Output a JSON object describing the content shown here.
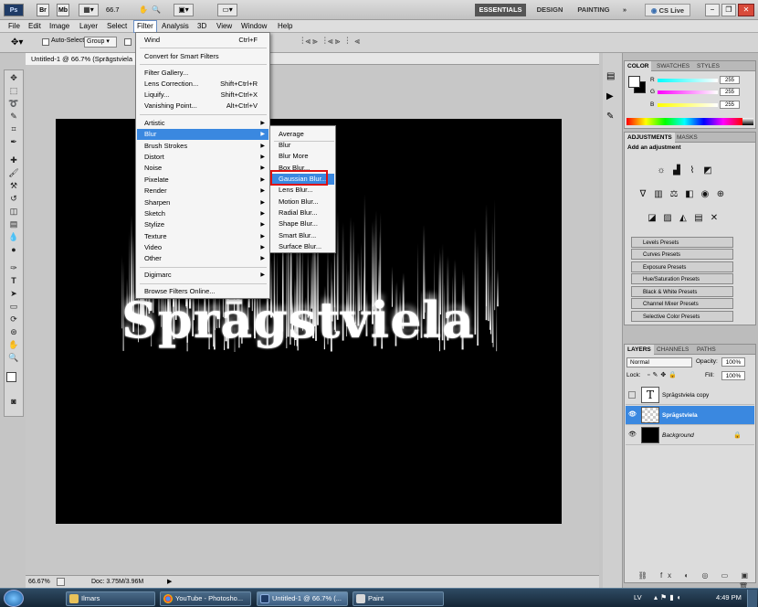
{
  "appbar": {
    "br_label": "Br",
    "mb_label": "Mb",
    "zoom_value": "66.7",
    "workspaces": [
      "ESSENTIALS",
      "DESIGN",
      "PAINTING"
    ],
    "overflow": "»",
    "cslive_label": "CS Live"
  },
  "menubar": [
    "File",
    "Edit",
    "Image",
    "Layer",
    "Select",
    "Filter",
    "Analysis",
    "3D",
    "View",
    "Window",
    "Help"
  ],
  "options": {
    "auto_select_label": "Auto-Select:",
    "auto_select_value": "Group"
  },
  "document": {
    "tab_title": "Untitled-1 @ 66.7% (Sprāgstviela",
    "canvas_text": "Sprāgstviela"
  },
  "filter_menu": {
    "items": [
      {
        "label": "Wind",
        "shortcut": "Ctrl+F"
      },
      {
        "label": "Convert for Smart Filters"
      },
      {
        "label": "Filter Gallery..."
      },
      {
        "label": "Lens Correction...",
        "shortcut": "Shift+Ctrl+R"
      },
      {
        "label": "Liquify...",
        "shortcut": "Shift+Ctrl+X"
      },
      {
        "label": "Vanishing Point...",
        "shortcut": "Alt+Ctrl+V"
      },
      {
        "label": "Artistic"
      },
      {
        "label": "Blur"
      },
      {
        "label": "Brush Strokes"
      },
      {
        "label": "Distort"
      },
      {
        "label": "Noise"
      },
      {
        "label": "Pixelate"
      },
      {
        "label": "Render"
      },
      {
        "label": "Sharpen"
      },
      {
        "label": "Sketch"
      },
      {
        "label": "Stylize"
      },
      {
        "label": "Texture"
      },
      {
        "label": "Video"
      },
      {
        "label": "Other"
      },
      {
        "label": "Digimarc"
      },
      {
        "label": "Browse Filters Online..."
      }
    ]
  },
  "blur_menu": {
    "items": [
      "Average",
      "Blur",
      "Blur More",
      "Box Blur...",
      "Gaussian Blur...",
      "Lens Blur...",
      "Motion Blur...",
      "Radial Blur...",
      "Shape Blur...",
      "Smart Blur...",
      "Surface Blur..."
    ]
  },
  "status": {
    "zoom": "66.67%",
    "doc": "Doc: 3.75M/3.96M"
  },
  "color_panel": {
    "tabs": [
      "COLOR",
      "SWATCHES",
      "STYLES"
    ],
    "channels": [
      {
        "label": "R",
        "value": "255"
      },
      {
        "label": "G",
        "value": "255"
      },
      {
        "label": "B",
        "value": "255"
      }
    ]
  },
  "adjustments_panel": {
    "tabs": [
      "ADJUSTMENTS",
      "MASKS"
    ],
    "heading": "Add an adjustment",
    "presets": [
      "Levels Presets",
      "Curves Presets",
      "Exposure Presets",
      "Hue/Saturation Presets",
      "Black & White Presets",
      "Channel Mixer Presets",
      "Selective Color Presets"
    ]
  },
  "layers_panel": {
    "tabs": [
      "LAYERS",
      "CHANNELS",
      "PATHS"
    ],
    "blend_mode": "Normal",
    "opacity_label": "Opacity:",
    "opacity_value": "100%",
    "lock_label": "Lock:",
    "fill_label": "Fill:",
    "fill_value": "100%",
    "layers": [
      {
        "name": "Sprāgstviela copy"
      },
      {
        "name": "Sprāgstviela"
      },
      {
        "name": "Background"
      }
    ]
  },
  "taskbar": {
    "items": [
      "Ilmars",
      "YouTube - Photosho...",
      "Untitled-1 @ 66.7% (...",
      "Paint"
    ],
    "lang": "LV",
    "clock": "4:49 PM"
  },
  "colors": {
    "highlight": "#3a88e0",
    "red_box": "#dd1111"
  }
}
